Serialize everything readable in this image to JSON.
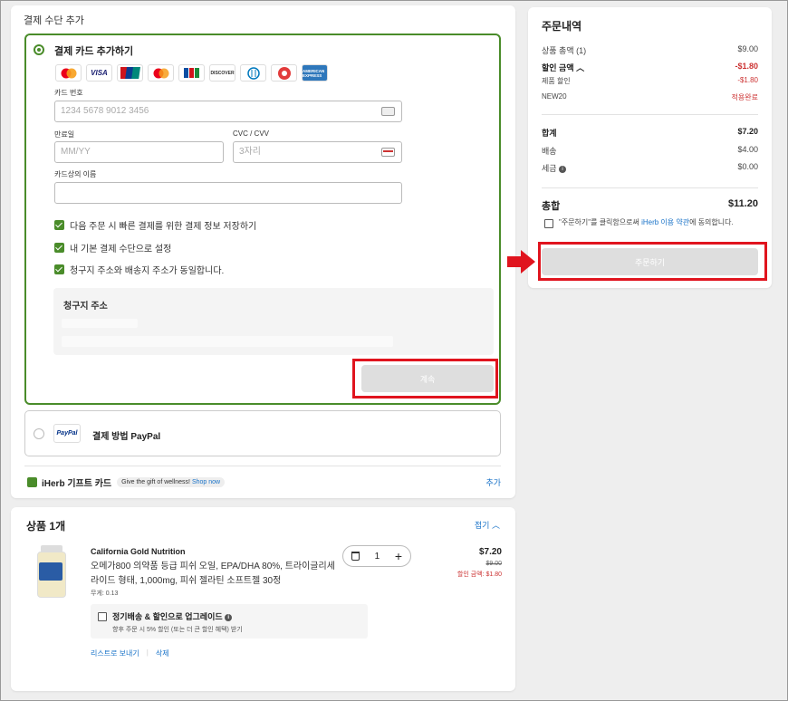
{
  "payment": {
    "section_title": "결제 수단 추가",
    "card_option_title": "결제 카드 추가하기",
    "card_logos": [
      "mastercard-icon",
      "visa-icon",
      "unionpay-icon",
      "maestro-icon",
      "jcb-icon",
      "discover-icon",
      "diners-icon",
      "card-icon",
      "amex-icon"
    ],
    "logo_visa_text": "VISA",
    "logo_discover_text": "DISCOVER",
    "logo_amex_text": "AMERICAN EXPRESS",
    "card_number_label": "카드 번호",
    "card_number_placeholder": "1234 5678 9012 3456",
    "expiry_label": "만료일",
    "expiry_placeholder": "MM/YY",
    "cvc_label": "CVC / CVV",
    "cvc_placeholder": "3자리",
    "holder_label": "카드상의 이름",
    "holder_value": "",
    "checkboxes": [
      "다음 주문 시 빠른 결제를 위한 결제 정보 저장하기",
      "내 기본 결제 수단으로 설정",
      "청구지 주소와 배송지 주소가 동일합니다."
    ],
    "billing_title": "청구지 주소",
    "continue_label": "계속",
    "paypal_logo": "PayPal",
    "paypal_label": "결제 방법 PayPal",
    "gift_title": "iHerb 기프트 카드",
    "gift_promo": "Give the gift of wellness!",
    "gift_promo_link": "Shop now",
    "gift_add": "추가"
  },
  "products": {
    "title": "상품 1개",
    "toggle_label": "접기",
    "item": {
      "brand": "California Gold Nutrition",
      "name": "오메가800 의약품 등급 피쉬 오일, EPA/DHA 80%, 트라이글리세라이드 형태, 1,000mg, 피쉬 젤라틴 소프트젤 30정",
      "weight": "무게: 0.13",
      "quantity": "1",
      "price": "$7.20",
      "old_price": "$9.00",
      "discount_price": "할인 금액: $1.80",
      "subscribe_title": "정기배송 & 할인으로 업그레이드",
      "subscribe_desc": "향후 주문 시 5% 할인 (또는 더 큰 할인 혜택) 받기",
      "link_save": "리스트로 보내기",
      "link_delete": "삭제"
    }
  },
  "summary": {
    "title": "주문내역",
    "subtotal_label": "상품 총액 (1)",
    "subtotal_value": "$9.00",
    "discount_label": "할인 금액",
    "discount_value": "-$1.80",
    "product_discount_label": "제품 할인",
    "product_discount_value": "-$1.80",
    "promo_code": "NEW20",
    "promo_status": "적용완료",
    "sum_label": "합계",
    "sum_value": "$7.20",
    "shipping_label": "배송",
    "shipping_value": "$4.00",
    "tax_label": "세금",
    "tax_value": "$0.00",
    "total_label": "총합",
    "total_value": "$11.20",
    "agree_prefix": "\"주문하기\"를 클릭함으로써 ",
    "agree_link": "iHerb 이용 약관",
    "agree_suffix": "에 동의합니다.",
    "order_label": "주문하기"
  },
  "colors": {
    "accent_green": "#4a8c2a",
    "highlight_red": "#e0141e",
    "link_blue": "#1a73c8",
    "discount_red": "#c33333"
  }
}
